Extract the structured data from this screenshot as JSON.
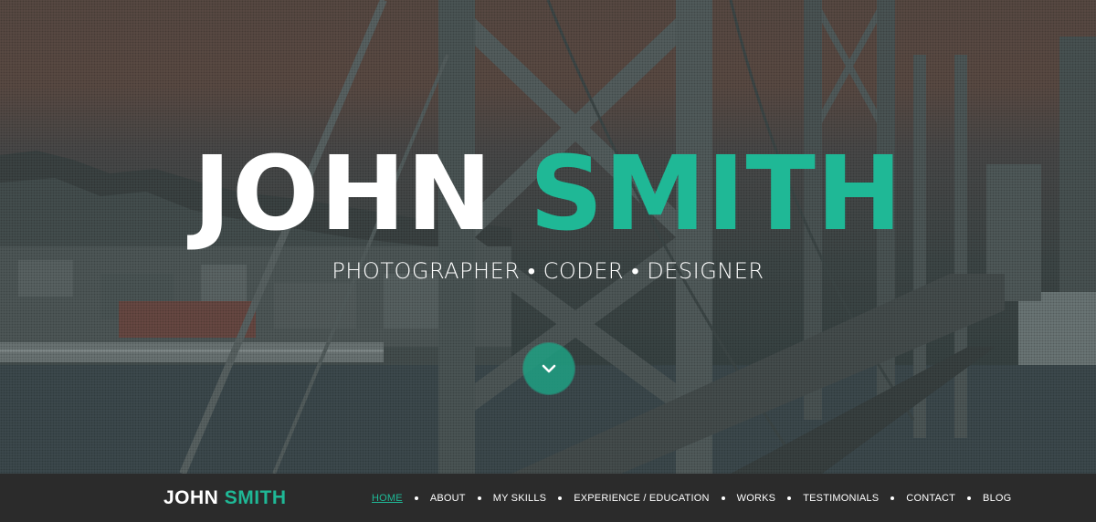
{
  "hero": {
    "first_name": "JOHN",
    "last_name": "SMITH",
    "subtitle": "PHOTOGRAPHER • CODER • DESIGNER",
    "scroll_icon": "chevron-down-icon"
  },
  "navbar": {
    "brand_first": "JOHN",
    "brand_last": "SMITH",
    "items": [
      {
        "label": "HOME",
        "active": true
      },
      {
        "label": "ABOUT"
      },
      {
        "label": "MY SKILLS"
      },
      {
        "label": "EXPERIENCE / EDUCATION"
      },
      {
        "label": "WORKS"
      },
      {
        "label": "TESTIMONIALS"
      },
      {
        "label": "CONTACT"
      },
      {
        "label": "BLOG"
      }
    ]
  },
  "colors": {
    "accent": "#1fb896",
    "navbar_bg": "#2b2b2b",
    "text": "#ffffff"
  }
}
